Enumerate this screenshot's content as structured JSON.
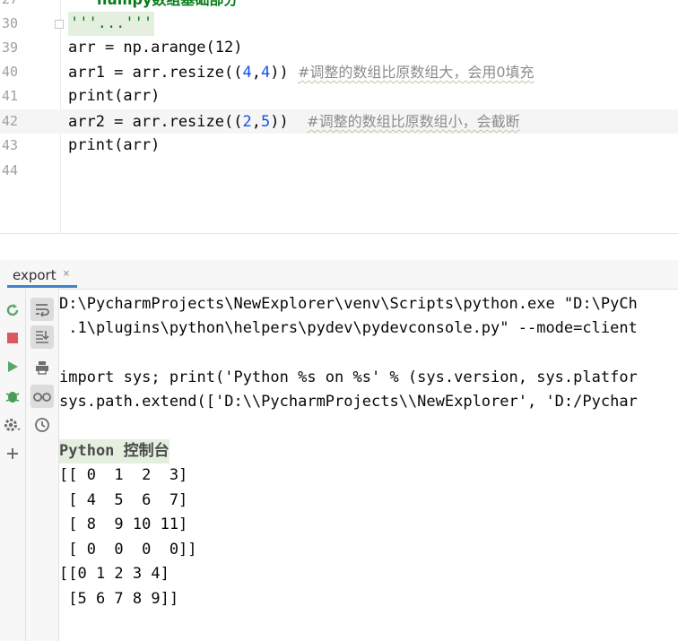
{
  "editor": {
    "lines": [
      {
        "num": "",
        "text": "numpy数组基础部分"
      },
      {
        "num": "30",
        "text": "'''...'''"
      },
      {
        "num": "39",
        "code": "arr = np.arange(12)"
      },
      {
        "num": "40",
        "code_a": "arr1 = arr.resize((",
        "n1": "4",
        "comma": ",",
        "n2": "4",
        "code_b": ")) ",
        "comment": "#调整的数组比原数组大，会用0填充"
      },
      {
        "num": "41",
        "code": "print(arr)"
      },
      {
        "num": "42",
        "code_a": "arr2 = arr.resize((",
        "n1": "2",
        "comma": ",",
        "n2": "5",
        "code_b": "))  ",
        "comment": "#调整的数组比原数组小，会截断"
      },
      {
        "num": "43",
        "code": "print(arr)"
      },
      {
        "num": "44",
        "code": ""
      }
    ]
  },
  "run_panel": {
    "tab_label": "export",
    "tab_close": "×"
  },
  "console": {
    "lines": [
      "D:\\PycharmProjects\\NewExplorer\\venv\\Scripts\\python.exe \"D:\\PyCh",
      " .1\\plugins\\python\\helpers\\pydev\\pydevconsole.py\" --mode=client",
      "",
      "import sys; print('Python %s on %s' % (sys.version, sys.platfor",
      "sys.path.extend(['D:\\\\PycharmProjects\\\\NewExplorer', 'D:/Pychar",
      "",
      "Python 控制台",
      "[[ 0  1  2  3]",
      " [ 4  5  6  7]",
      " [ 8  9 10 11]",
      " [ 0  0  0  0]]",
      "[[0 1 2 3 4]",
      " [5 6 7 8 9]]"
    ]
  },
  "colors": {
    "run_green": "#59a869",
    "stop_red": "#db5860",
    "debug_green": "#499c54",
    "tab_accent": "#4083c9"
  }
}
